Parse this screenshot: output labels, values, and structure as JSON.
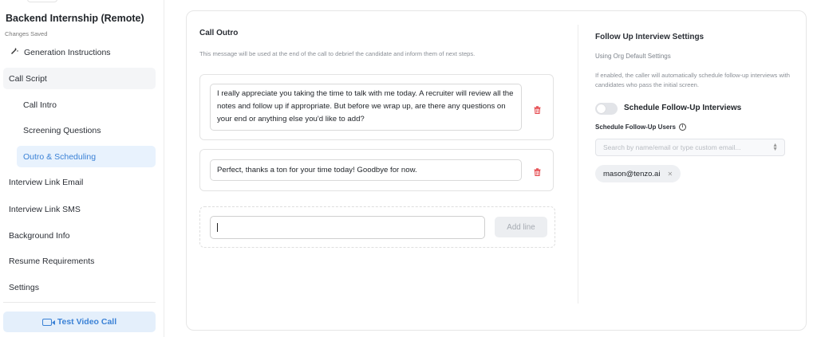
{
  "sidebar": {
    "job_title": "Backend Internship (Remote)",
    "save_status": "Changes Saved",
    "items": [
      {
        "label": "Generation Instructions",
        "icon": "magic-wand-icon"
      },
      {
        "label": "Call Script"
      },
      {
        "label": "Call Intro"
      },
      {
        "label": "Screening Questions"
      },
      {
        "label": "Outro & Scheduling"
      },
      {
        "label": "Interview Link Email"
      },
      {
        "label": "Interview Link SMS"
      },
      {
        "label": "Background Info"
      },
      {
        "label": "Resume Requirements"
      },
      {
        "label": "Settings"
      }
    ],
    "test_button": {
      "label": "Test Video Call",
      "icon": "video-camera-icon"
    }
  },
  "outro": {
    "title": "Call Outro",
    "description": "This message will be used at the end of the call to debrief the candidate and inform them of next steps.",
    "lines": [
      {
        "text": "I really appreciate you taking the time to talk with me today. A recruiter will review all the notes and follow up if appropriate. But before we wrap up, are there any questions on your end or anything else you'd like to add?"
      },
      {
        "text": "Perfect, thanks a ton for your time today! Goodbye for now."
      }
    ],
    "new_line_value": "",
    "add_button_label": "Add line"
  },
  "follow_up": {
    "title": "Follow Up Interview Settings",
    "subtitle": "Using Org Default Settings",
    "description": "If enabled, the caller will automatically schedule follow-up interviews with candidates who pass the initial screen.",
    "toggle_label": "Schedule Follow-Up Interviews",
    "toggle_enabled": false,
    "users_label": "Schedule Follow-Up Users",
    "users_placeholder": "Search by name/email or type custom email...",
    "users": [
      "mason@tenzo.ai"
    ]
  },
  "colors": {
    "accent": "#3b82d6",
    "active_bg": "#e8f2fd",
    "delete_red": "#e5484d"
  }
}
